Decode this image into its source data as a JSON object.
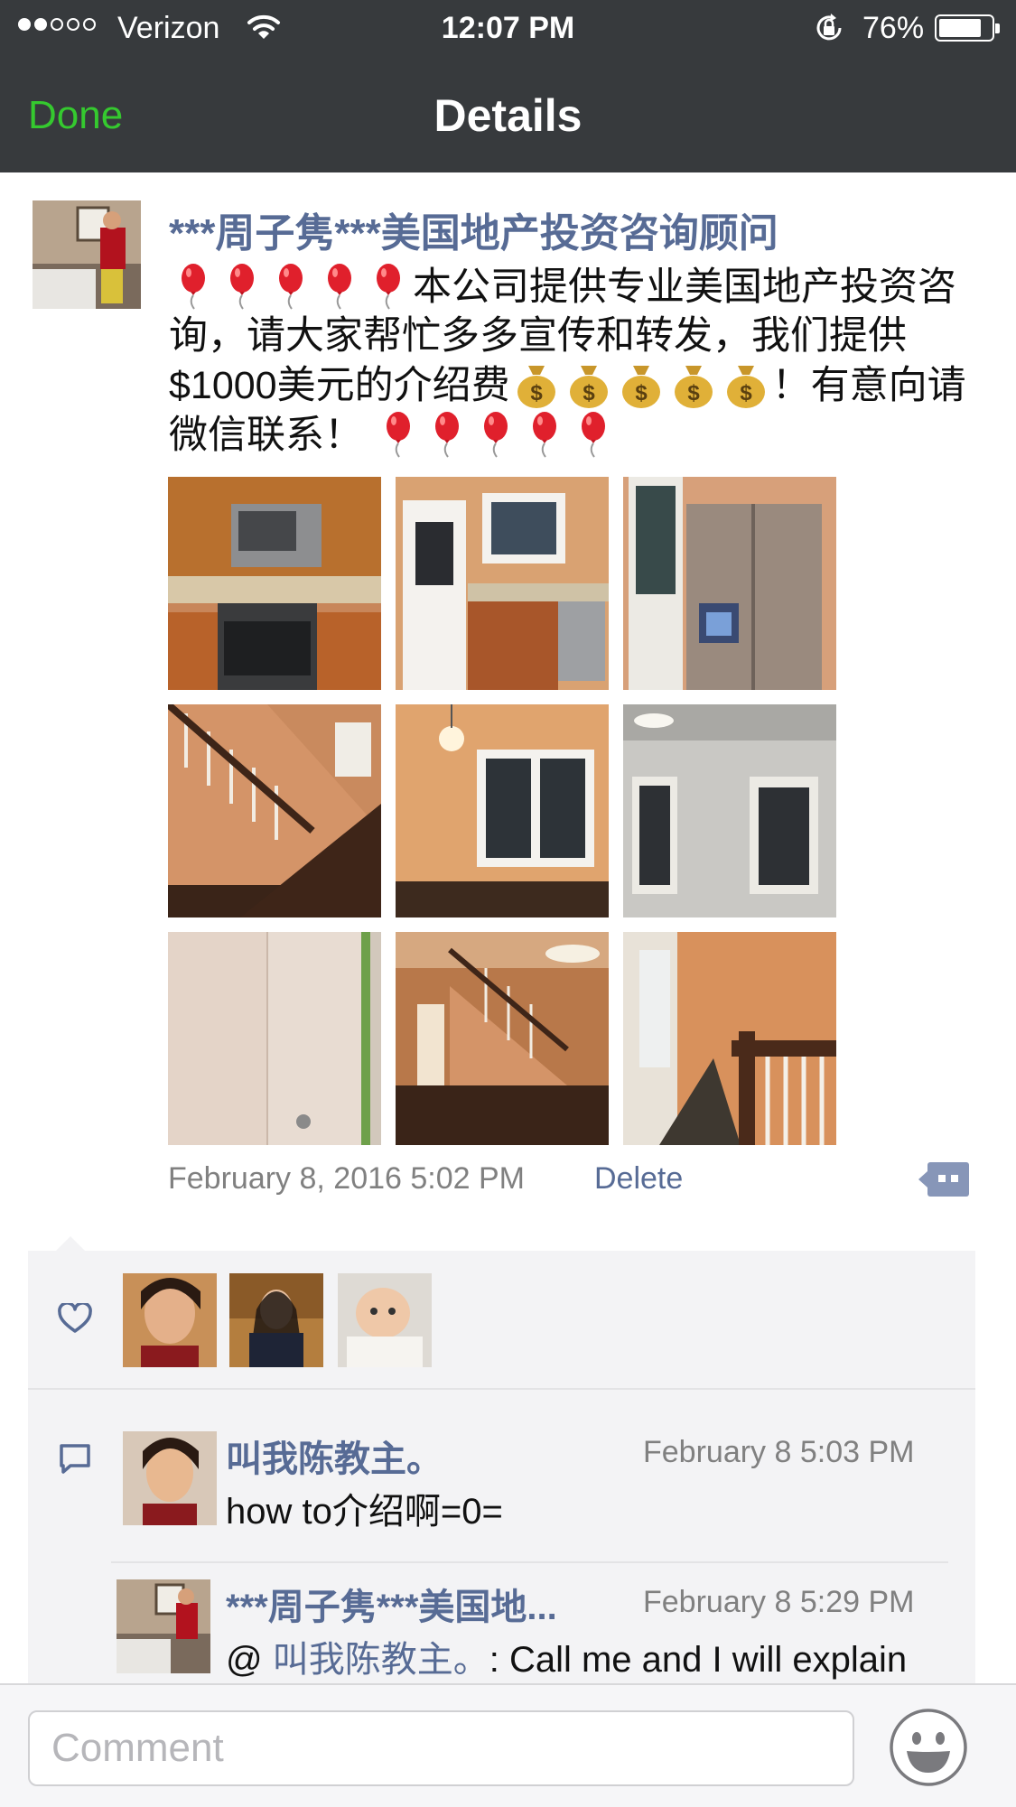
{
  "status_bar": {
    "carrier": "Verizon",
    "time": "12:07 PM",
    "battery_percent": "76%",
    "battery_level": 0.76,
    "signal_dots_filled": 2,
    "signal_dots_total": 5
  },
  "nav": {
    "done_label": "Done",
    "title": "Details"
  },
  "post": {
    "author": "***周子隽***美国地产投资咨询顾问",
    "text_segments": {
      "line_a": "本公司提供专业美国地产投资咨询，请大家帮忙多多宣传和转发，我们提供$1000美元的介绍费",
      "line_b": "！有意向请微信联系！"
    },
    "timestamp": "February 8, 2016 5:02 PM",
    "delete_label": "Delete",
    "photos": [
      "kitchen-stove",
      "kitchen-sink",
      "refrigerator",
      "staircase",
      "room-windows",
      "white-room",
      "empty-corner",
      "hallway-stairs",
      "upstairs-hall"
    ]
  },
  "likes": {
    "likers": [
      "liker-1",
      "liker-2",
      "liker-3"
    ]
  },
  "comments": [
    {
      "author": "叫我陈教主。",
      "time": "February 8 5:03 PM",
      "text": "how to介绍啊=0="
    },
    {
      "author": "***周子隽***美国地...",
      "time": "February 8 5:29 PM",
      "reply_prefix": "@ ",
      "reply_to": "叫我陈教主。",
      "text": ": Call me and I will explain"
    }
  ],
  "composer": {
    "placeholder": "Comment"
  },
  "colors": {
    "nav_bg": "#373a3d",
    "done_green": "#35c92f",
    "link_blue": "#576b95",
    "panel_bg": "#f3f3f5"
  }
}
